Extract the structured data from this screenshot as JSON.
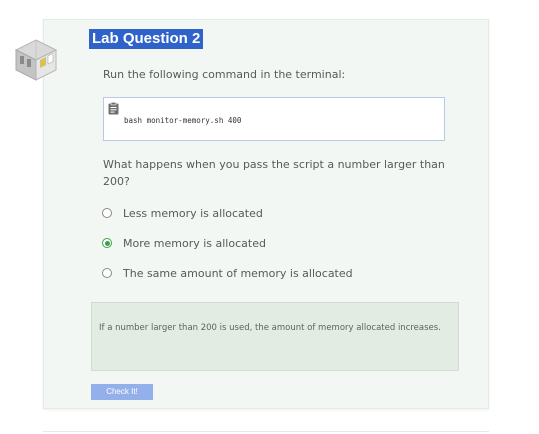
{
  "lab": {
    "title": "Lab Question 2",
    "icon": "building-icon"
  },
  "instruction": "Run the following command in the terminal:",
  "code": {
    "icon": "clipboard-icon",
    "command": "bash monitor-memory.sh 400"
  },
  "question": "What happens when you pass the script a number larger than 200?",
  "options": [
    {
      "label": "Less memory is allocated",
      "selected": false
    },
    {
      "label": "More memory is allocated",
      "selected": true
    },
    {
      "label": "The same amount of memory is allocated",
      "selected": false
    }
  ],
  "feedback": "If a number larger than 200 is used, the amount of memory allocated increases.",
  "check_button": "Check It!",
  "colors": {
    "title_bg": "#2f63c9",
    "selected_radio": "#3f9e4a",
    "button_bg": "#93b0ea"
  }
}
